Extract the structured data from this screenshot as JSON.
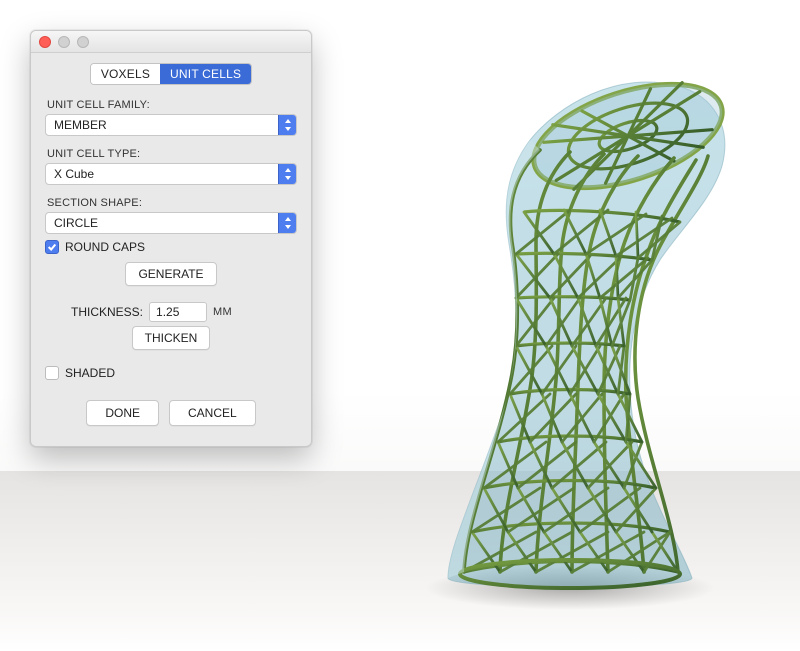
{
  "tabs": {
    "voxels": "VOXELS",
    "unit_cells": "UNIT CELLS",
    "active": "unit_cells"
  },
  "labels": {
    "family": "UNIT CELL FAMILY:",
    "type": "UNIT CELL TYPE:",
    "section": "SECTION SHAPE:",
    "round_caps": "ROUND CAPS",
    "thickness": "THICKNESS:",
    "thickness_unit": "MM",
    "shaded": "SHADED"
  },
  "values": {
    "family": "MEMBER",
    "type": "X Cube",
    "section": "CIRCLE",
    "round_caps_checked": true,
    "thickness": "1.25",
    "shaded_checked": false
  },
  "buttons": {
    "generate": "GENERATE",
    "thicken": "THICKEN",
    "done": "DONE",
    "cancel": "CANCEL"
  },
  "icons": {
    "close": "close-icon",
    "minimize": "minimize-icon",
    "maximize": "maximize-icon",
    "updown": "updown-chevrons-icon",
    "check": "check-icon"
  },
  "colors": {
    "accent": "#4e7df0",
    "lattice": "#517c3a",
    "envelope": "#9fc6d6"
  }
}
